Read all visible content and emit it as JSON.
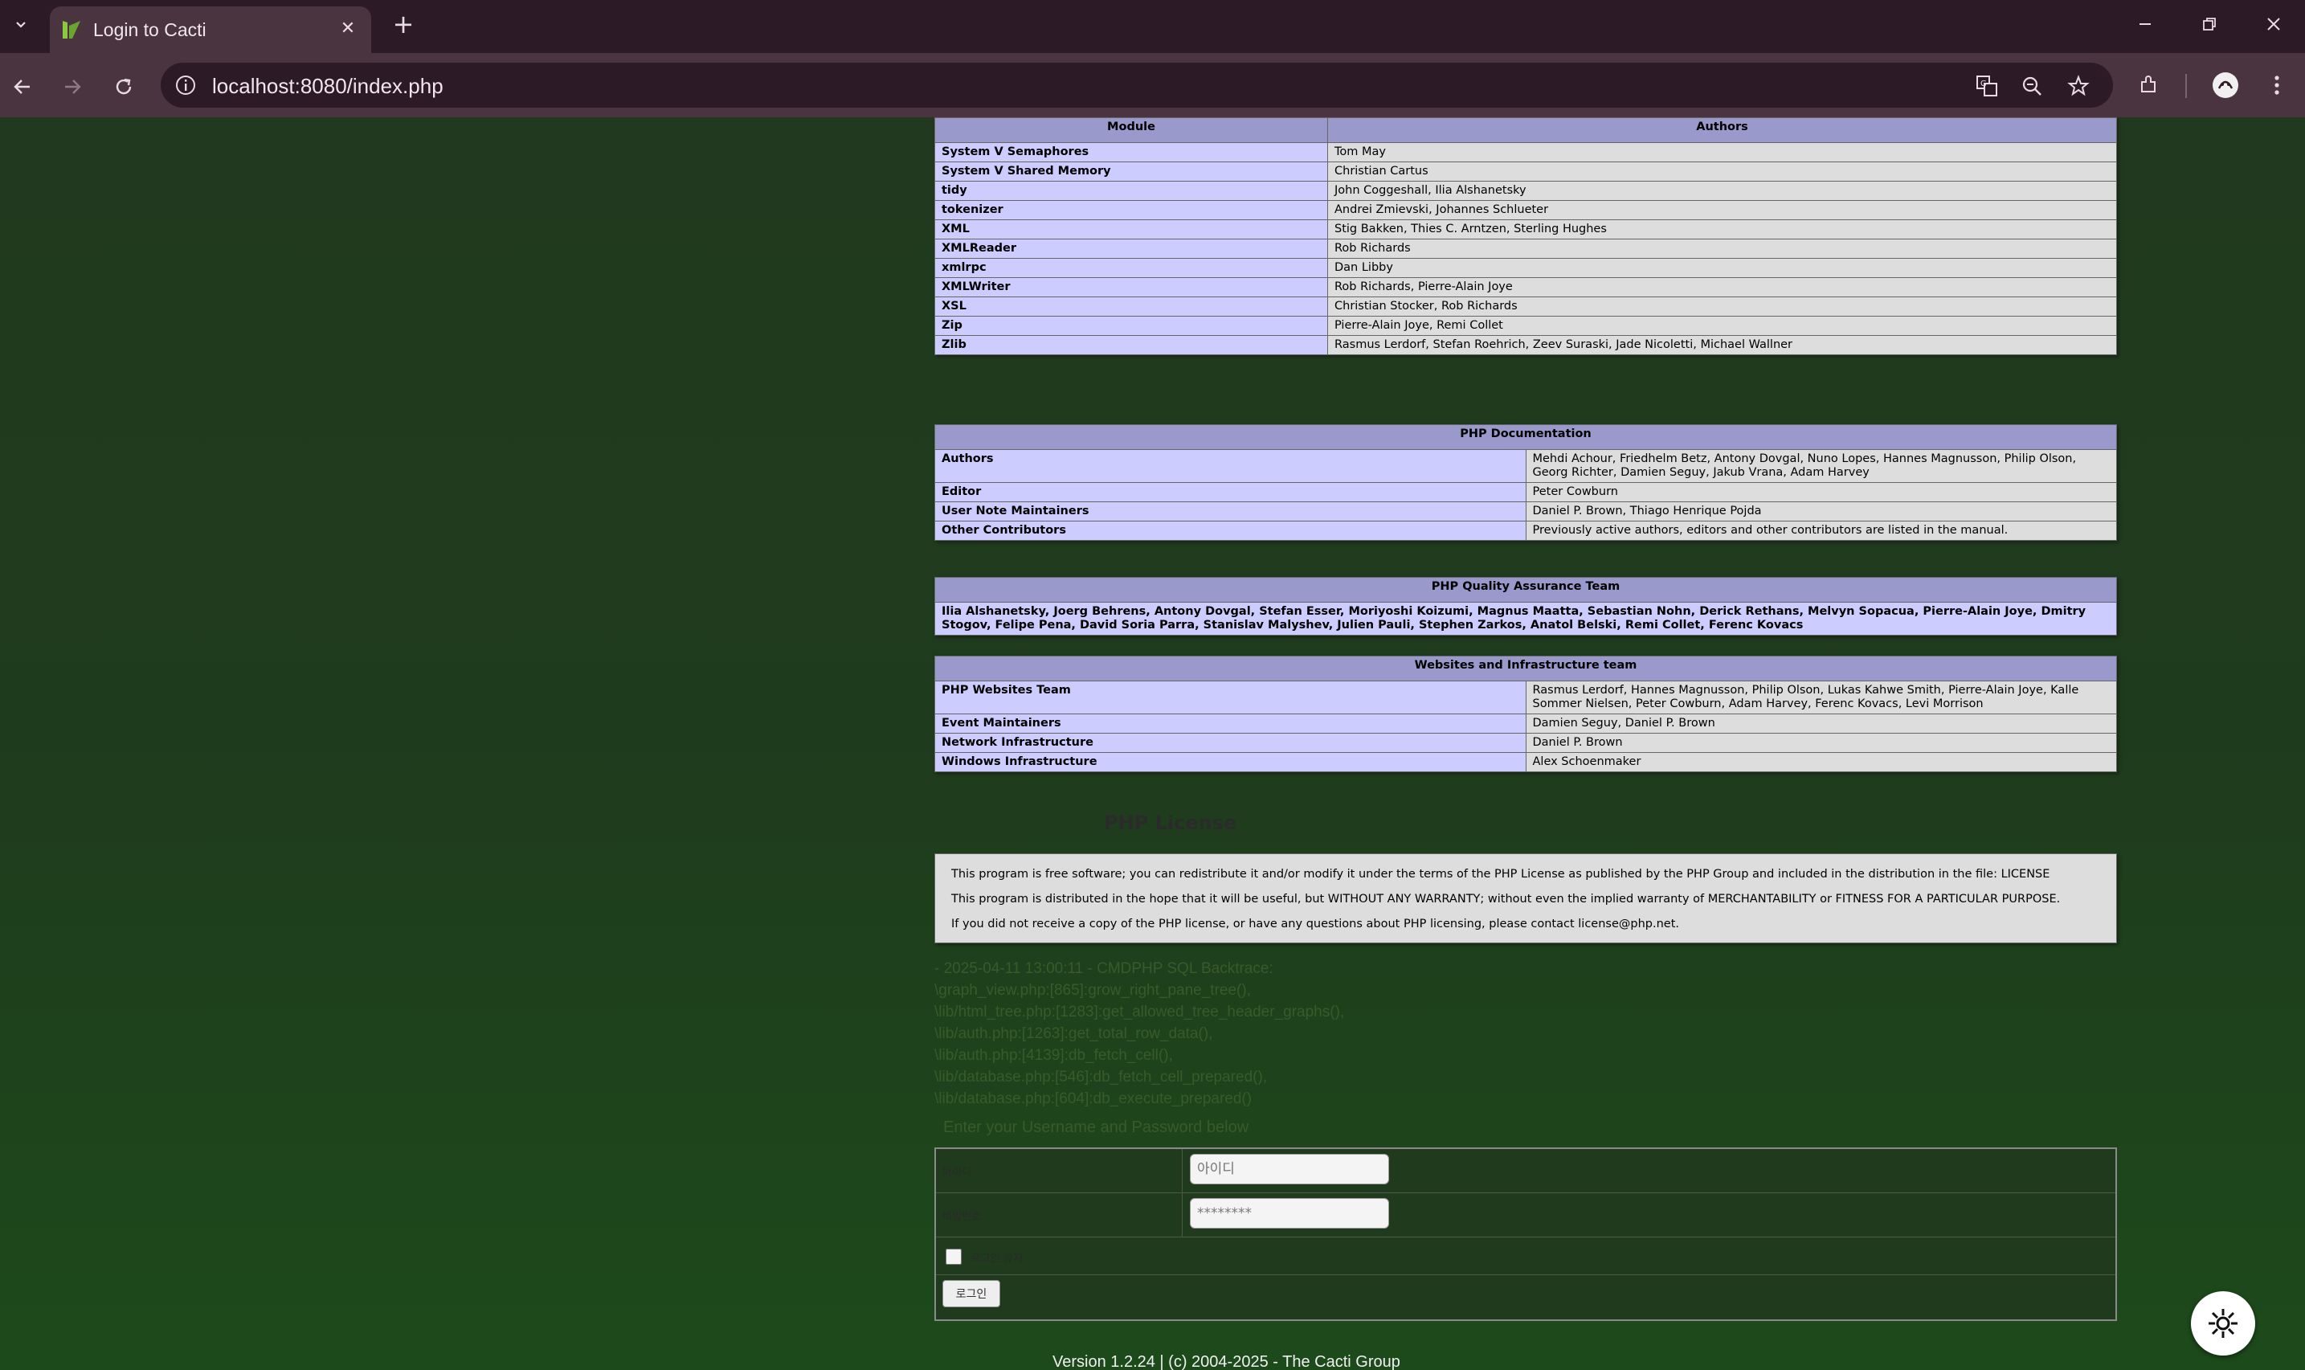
{
  "browser": {
    "tab_title": "Login to Cacti",
    "url": "localhost:8080/index.php"
  },
  "modules_table": {
    "headers": [
      "Module",
      "Authors"
    ],
    "rows": [
      {
        "module": "System V Semaphores",
        "authors": "Tom May"
      },
      {
        "module": "System V Shared Memory",
        "authors": "Christian Cartus"
      },
      {
        "module": "tidy",
        "authors": "John Coggeshall, Ilia Alshanetsky"
      },
      {
        "module": "tokenizer",
        "authors": "Andrei Zmievski, Johannes Schlueter"
      },
      {
        "module": "XML",
        "authors": "Stig Bakken, Thies C. Arntzen, Sterling Hughes"
      },
      {
        "module": "XMLReader",
        "authors": "Rob Richards"
      },
      {
        "module": "xmlrpc",
        "authors": "Dan Libby"
      },
      {
        "module": "XMLWriter",
        "authors": "Rob Richards, Pierre-Alain Joye"
      },
      {
        "module": "XSL",
        "authors": "Christian Stocker, Rob Richards"
      },
      {
        "module": "Zip",
        "authors": "Pierre-Alain Joye, Remi Collet"
      },
      {
        "module": "Zlib",
        "authors": "Rasmus Lerdorf, Stefan Roehrich, Zeev Suraski, Jade Nicoletti, Michael Wallner"
      }
    ]
  },
  "documentation_table": {
    "header": "PHP Documentation",
    "rows": [
      {
        "role": "Authors",
        "people": "Mehdi Achour, Friedhelm Betz, Antony Dovgal, Nuno Lopes, Hannes Magnusson, Philip Olson, Georg Richter, Damien Seguy, Jakub Vrana, Adam Harvey"
      },
      {
        "role": "Editor",
        "people": "Peter Cowburn"
      },
      {
        "role": "User Note Maintainers",
        "people": "Daniel P. Brown, Thiago Henrique Pojda"
      },
      {
        "role": "Other Contributors",
        "people": "Previously active authors, editors and other contributors are listed in the manual."
      }
    ]
  },
  "qa_table": {
    "header": "PHP Quality Assurance Team",
    "members": "Ilia Alshanetsky, Joerg Behrens, Antony Dovgal, Stefan Esser, Moriyoshi Koizumi, Magnus Maatta, Sebastian Nohn, Derick Rethans, Melvyn Sopacua, Pierre-Alain Joye, Dmitry Stogov, Felipe Pena, David Soria Parra, Stanislav Malyshev, Julien Pauli, Stephen Zarkos, Anatol Belski, Remi Collet, Ferenc Kovacs"
  },
  "infra_table": {
    "header": "Websites and Infrastructure team",
    "rows": [
      {
        "role": "PHP Websites Team",
        "people": "Rasmus Lerdorf, Hannes Magnusson, Philip Olson, Lukas Kahwe Smith, Pierre-Alain Joye, Kalle Sommer Nielsen, Peter Cowburn, Adam Harvey, Ferenc Kovacs, Levi Morrison"
      },
      {
        "role": "Event Maintainers",
        "people": "Damien Seguy, Daniel P. Brown"
      },
      {
        "role": "Network Infrastructure",
        "people": "Daniel P. Brown"
      },
      {
        "role": "Windows Infrastructure",
        "people": "Alex Schoenmaker"
      }
    ]
  },
  "license": {
    "heading": "PHP License",
    "lines": [
      "This program is free software; you can redistribute it and/or modify it under the terms of the PHP License as published by the PHP Group and included in the distribution in the file: LICENSE",
      "This program is distributed in the hope that it will be useful, but WITHOUT ANY WARRANTY; without even the implied warranty of MERCHANTABILITY or FITNESS FOR A PARTICULAR PURPOSE.",
      "If you did not receive a copy of the PHP license, or have any questions about PHP licensing, please contact license@php.net."
    ]
  },
  "backtrace": [
    "- 2025-04-11 13:00:11 - CMDPHP SQL Backtrace:",
    "\\graph_view.php:[865]:grow_right_pane_tree(),",
    "\\lib/html_tree.php:[1283]:get_allowed_tree_header_graphs(),",
    "\\lib/auth.php:[1263]:get_total_row_data(),",
    "\\lib/auth.php:[4139]:db_fetch_cell(),",
    "\\lib/database.php:[546]:db_fetch_cell_prepared(),",
    "\\lib/database.php:[604]:db_execute_prepared()"
  ],
  "login": {
    "hint": "Enter your Username and Password below",
    "username_label": "아이디",
    "username_placeholder": "아이디",
    "password_label": "비밀번호",
    "password_value": "********",
    "remember_label": "로그인 유지",
    "submit_label": "로그인"
  },
  "footer": {
    "version": "Version 1.2.24 | (c) 2004-2025 - The Cacti Group"
  }
}
